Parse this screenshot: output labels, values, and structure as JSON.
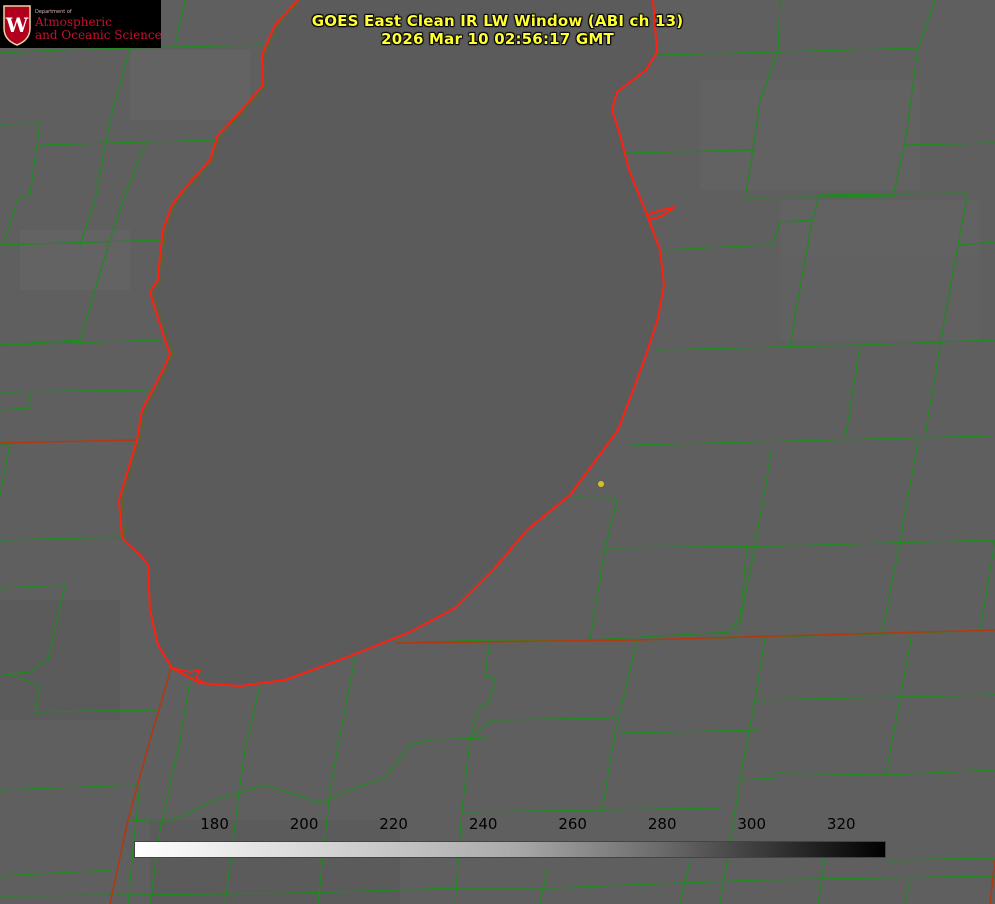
{
  "title": {
    "line1": "GOES East Clean IR LW Window (ABI ch 13)",
    "line2": "2026 Mar 10 02:56:17 GMT"
  },
  "logo": {
    "dept": "Department of",
    "line1": "Atmospheric",
    "line2": "and Oceanic Sciences",
    "crest_letter": "W",
    "crest_icon": "uw-crest-icon"
  },
  "colorbar": {
    "min": 162,
    "max": 330,
    "ticks": [
      "180",
      "200",
      "220",
      "240",
      "260",
      "280",
      "300",
      "320"
    ],
    "gradient": [
      "#ffffff",
      "#000000"
    ]
  },
  "colors": {
    "background": "#5f5f5f",
    "lake": "#5b5b5b",
    "county_lines": "#1f8a1f",
    "state_lines": "#b03a10",
    "shoreline": "#ff2010",
    "title_text": "#ffff33",
    "marker": "#d4c21f"
  }
}
